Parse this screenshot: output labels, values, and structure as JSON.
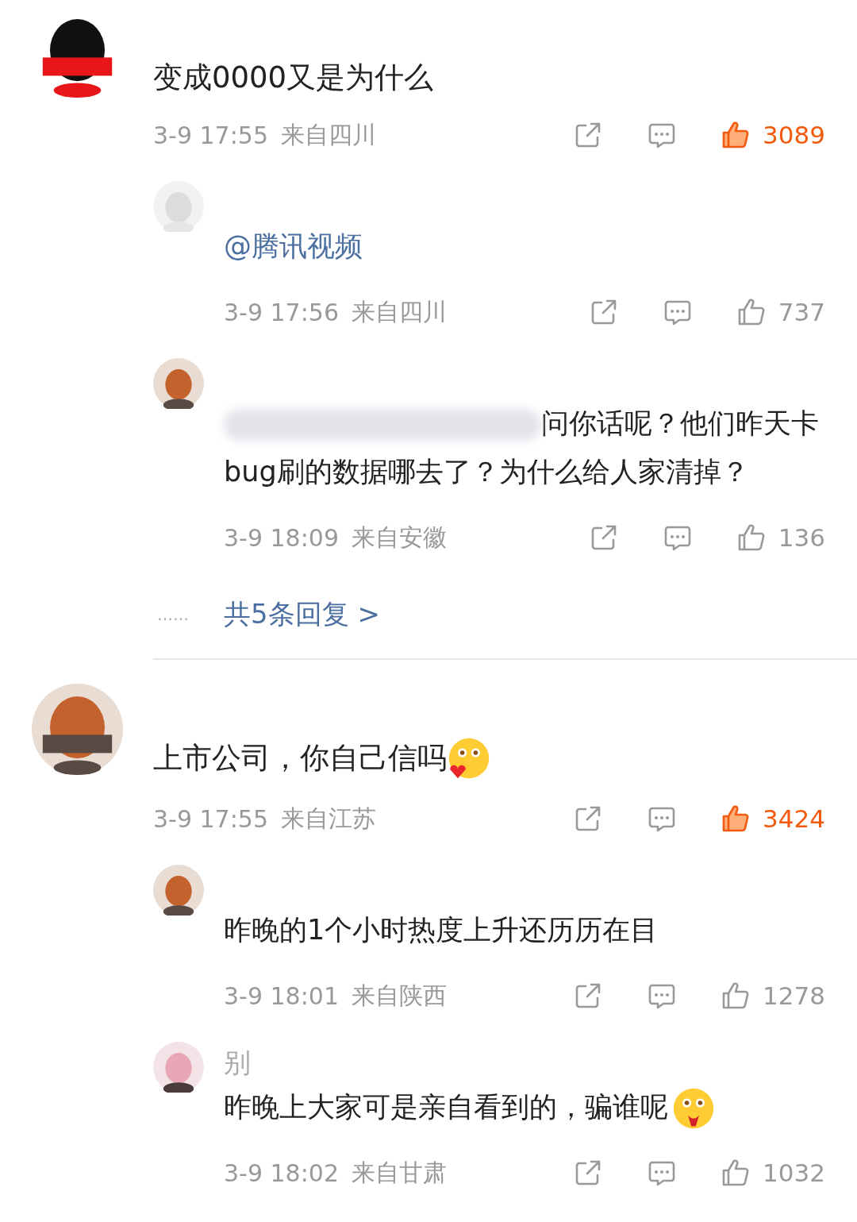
{
  "comments": [
    {
      "text": "变成0000又是为什么",
      "time": "3-9 17:55",
      "location": "来自四川",
      "likes": "3089",
      "liked": true,
      "replies": [
        {
          "kind": "mention",
          "text": "@腾讯视频",
          "time": "3-9 17:56",
          "location": "来自四川",
          "likes": "737",
          "liked": false
        },
        {
          "kind": "plain",
          "text": "问你话呢？他们昨天卡bug刷的数据哪去了？为什么给人家清掉？",
          "redacted": true,
          "time": "3-9 18:09",
          "location": "来自安徽",
          "likes": "136",
          "liked": false
        }
      ],
      "more": {
        "dots": "……",
        "label": "共5条回复 >"
      }
    },
    {
      "text": "上市公司，你自己信吗",
      "emoji": true,
      "time": "3-9 17:55",
      "location": "来自江苏",
      "likes": "3424",
      "liked": true,
      "replies": [
        {
          "kind": "plain",
          "text": "昨晚的1个小时热度上升还历历在目",
          "time": "3-9 18:01",
          "location": "来自陕西",
          "likes": "1278",
          "liked": false
        },
        {
          "kind": "plain",
          "username": "别",
          "text": "昨晚上大家可是亲自看到的，骗谁呢",
          "emoji": true,
          "time": "3-9 18:02",
          "location": "来自甘肃",
          "likes": "1032",
          "liked": false
        }
      ]
    }
  ]
}
